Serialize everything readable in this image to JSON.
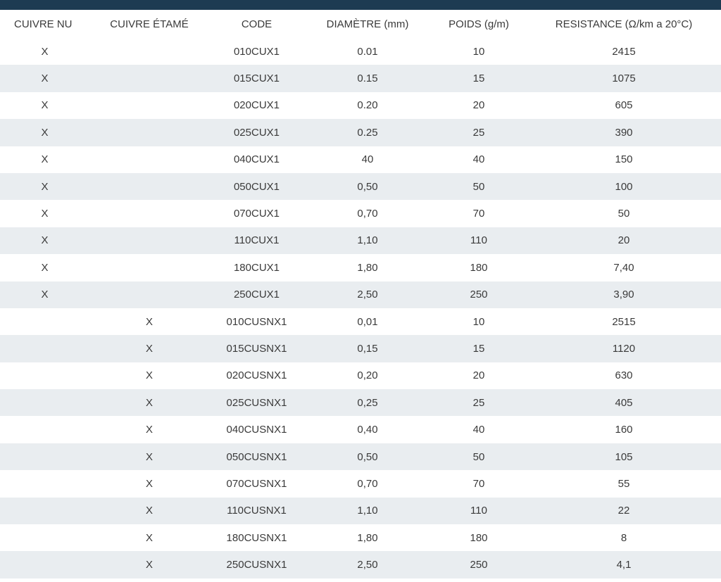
{
  "table": {
    "headers": [
      "CUIVRE NU",
      "CUIVRE ÉTAMÉ",
      "CODE",
      "DIAMÈTRE (mm)",
      "POIDS (g/m)",
      "RESISTANCE (Ω/km a 20°C)"
    ],
    "rows": [
      [
        "X",
        "",
        "010CUX1",
        "0.01",
        "10",
        "2415"
      ],
      [
        "X",
        "",
        "015CUX1",
        "0.15",
        "15",
        "1075"
      ],
      [
        "X",
        "",
        "020CUX1",
        "0.20",
        "20",
        "605"
      ],
      [
        "X",
        "",
        "025CUX1",
        "0.25",
        "25",
        "390"
      ],
      [
        "X",
        "",
        "040CUX1",
        "40",
        "40",
        "150"
      ],
      [
        "X",
        "",
        "050CUX1",
        "0,50",
        "50",
        "100"
      ],
      [
        "X",
        "",
        "070CUX1",
        "0,70",
        "70",
        "50"
      ],
      [
        "X",
        "",
        "110CUX1",
        "1,10",
        "110",
        "20"
      ],
      [
        "X",
        "",
        "180CUX1",
        "1,80",
        "180",
        "7,40"
      ],
      [
        "X",
        "",
        "250CUX1",
        "2,50",
        "250",
        "3,90"
      ],
      [
        "",
        "X",
        "010CUSNX1",
        "0,01",
        "10",
        "2515"
      ],
      [
        "",
        "X",
        "015CUSNX1",
        "0,15",
        "15",
        "1120"
      ],
      [
        "",
        "X",
        "020CUSNX1",
        "0,20",
        "20",
        "630"
      ],
      [
        "",
        "X",
        "025CUSNX1",
        "0,25",
        "25",
        "405"
      ],
      [
        "",
        "X",
        "040CUSNX1",
        "0,40",
        "40",
        "160"
      ],
      [
        "",
        "X",
        "050CUSNX1",
        "0,50",
        "50",
        "105"
      ],
      [
        "",
        "X",
        "070CUSNX1",
        "0,70",
        "70",
        "55"
      ],
      [
        "",
        "X",
        "110CUSNX1",
        "1,10",
        "110",
        "22"
      ],
      [
        "",
        "X",
        "180CUSNX1",
        "1,80",
        "180",
        "8"
      ],
      [
        "",
        "X",
        "250CUSNX1",
        "2,50",
        "250",
        "4,1"
      ]
    ]
  },
  "colors": {
    "header_bar": "#1d3b52",
    "stripe": "#e9edf0",
    "text": "#3a3a3a"
  }
}
